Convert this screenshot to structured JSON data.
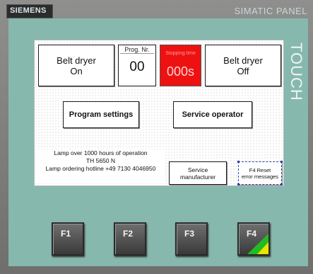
{
  "brand": {
    "logo": "SIEMENS",
    "model": "SIMATIC PANEL",
    "touch": "TOUCH"
  },
  "screen": {
    "belt_on": {
      "line1": "Belt dryer",
      "line2": "On"
    },
    "prog_nr": {
      "label": "Prog. Nr.",
      "value": "00"
    },
    "stopping_time": {
      "label": "Stopping time",
      "value": "000s"
    },
    "belt_off": {
      "line1": "Belt dryer",
      "line2": "Off"
    },
    "program_settings": "Program settings",
    "service_operator": "Service operator",
    "lamp_info": {
      "line1": "Lamp over 1000 hours of operation",
      "line2": "TH 5650 N",
      "line3": "Lamp ordering hotline +49 7130 4046950"
    },
    "service_manufacturer": {
      "line1": "Service",
      "line2": "manufacturer"
    },
    "f4_reset": {
      "line1": "F4 Reset",
      "line2": "error messages"
    }
  },
  "function_keys": [
    "F1",
    "F2",
    "F3",
    "F4"
  ],
  "colors": {
    "frame": "#86b8ae",
    "stop_bg": "#ee1111",
    "f4_accent_green": "#22bb22",
    "f4_accent_yellow": "#e6e600"
  }
}
